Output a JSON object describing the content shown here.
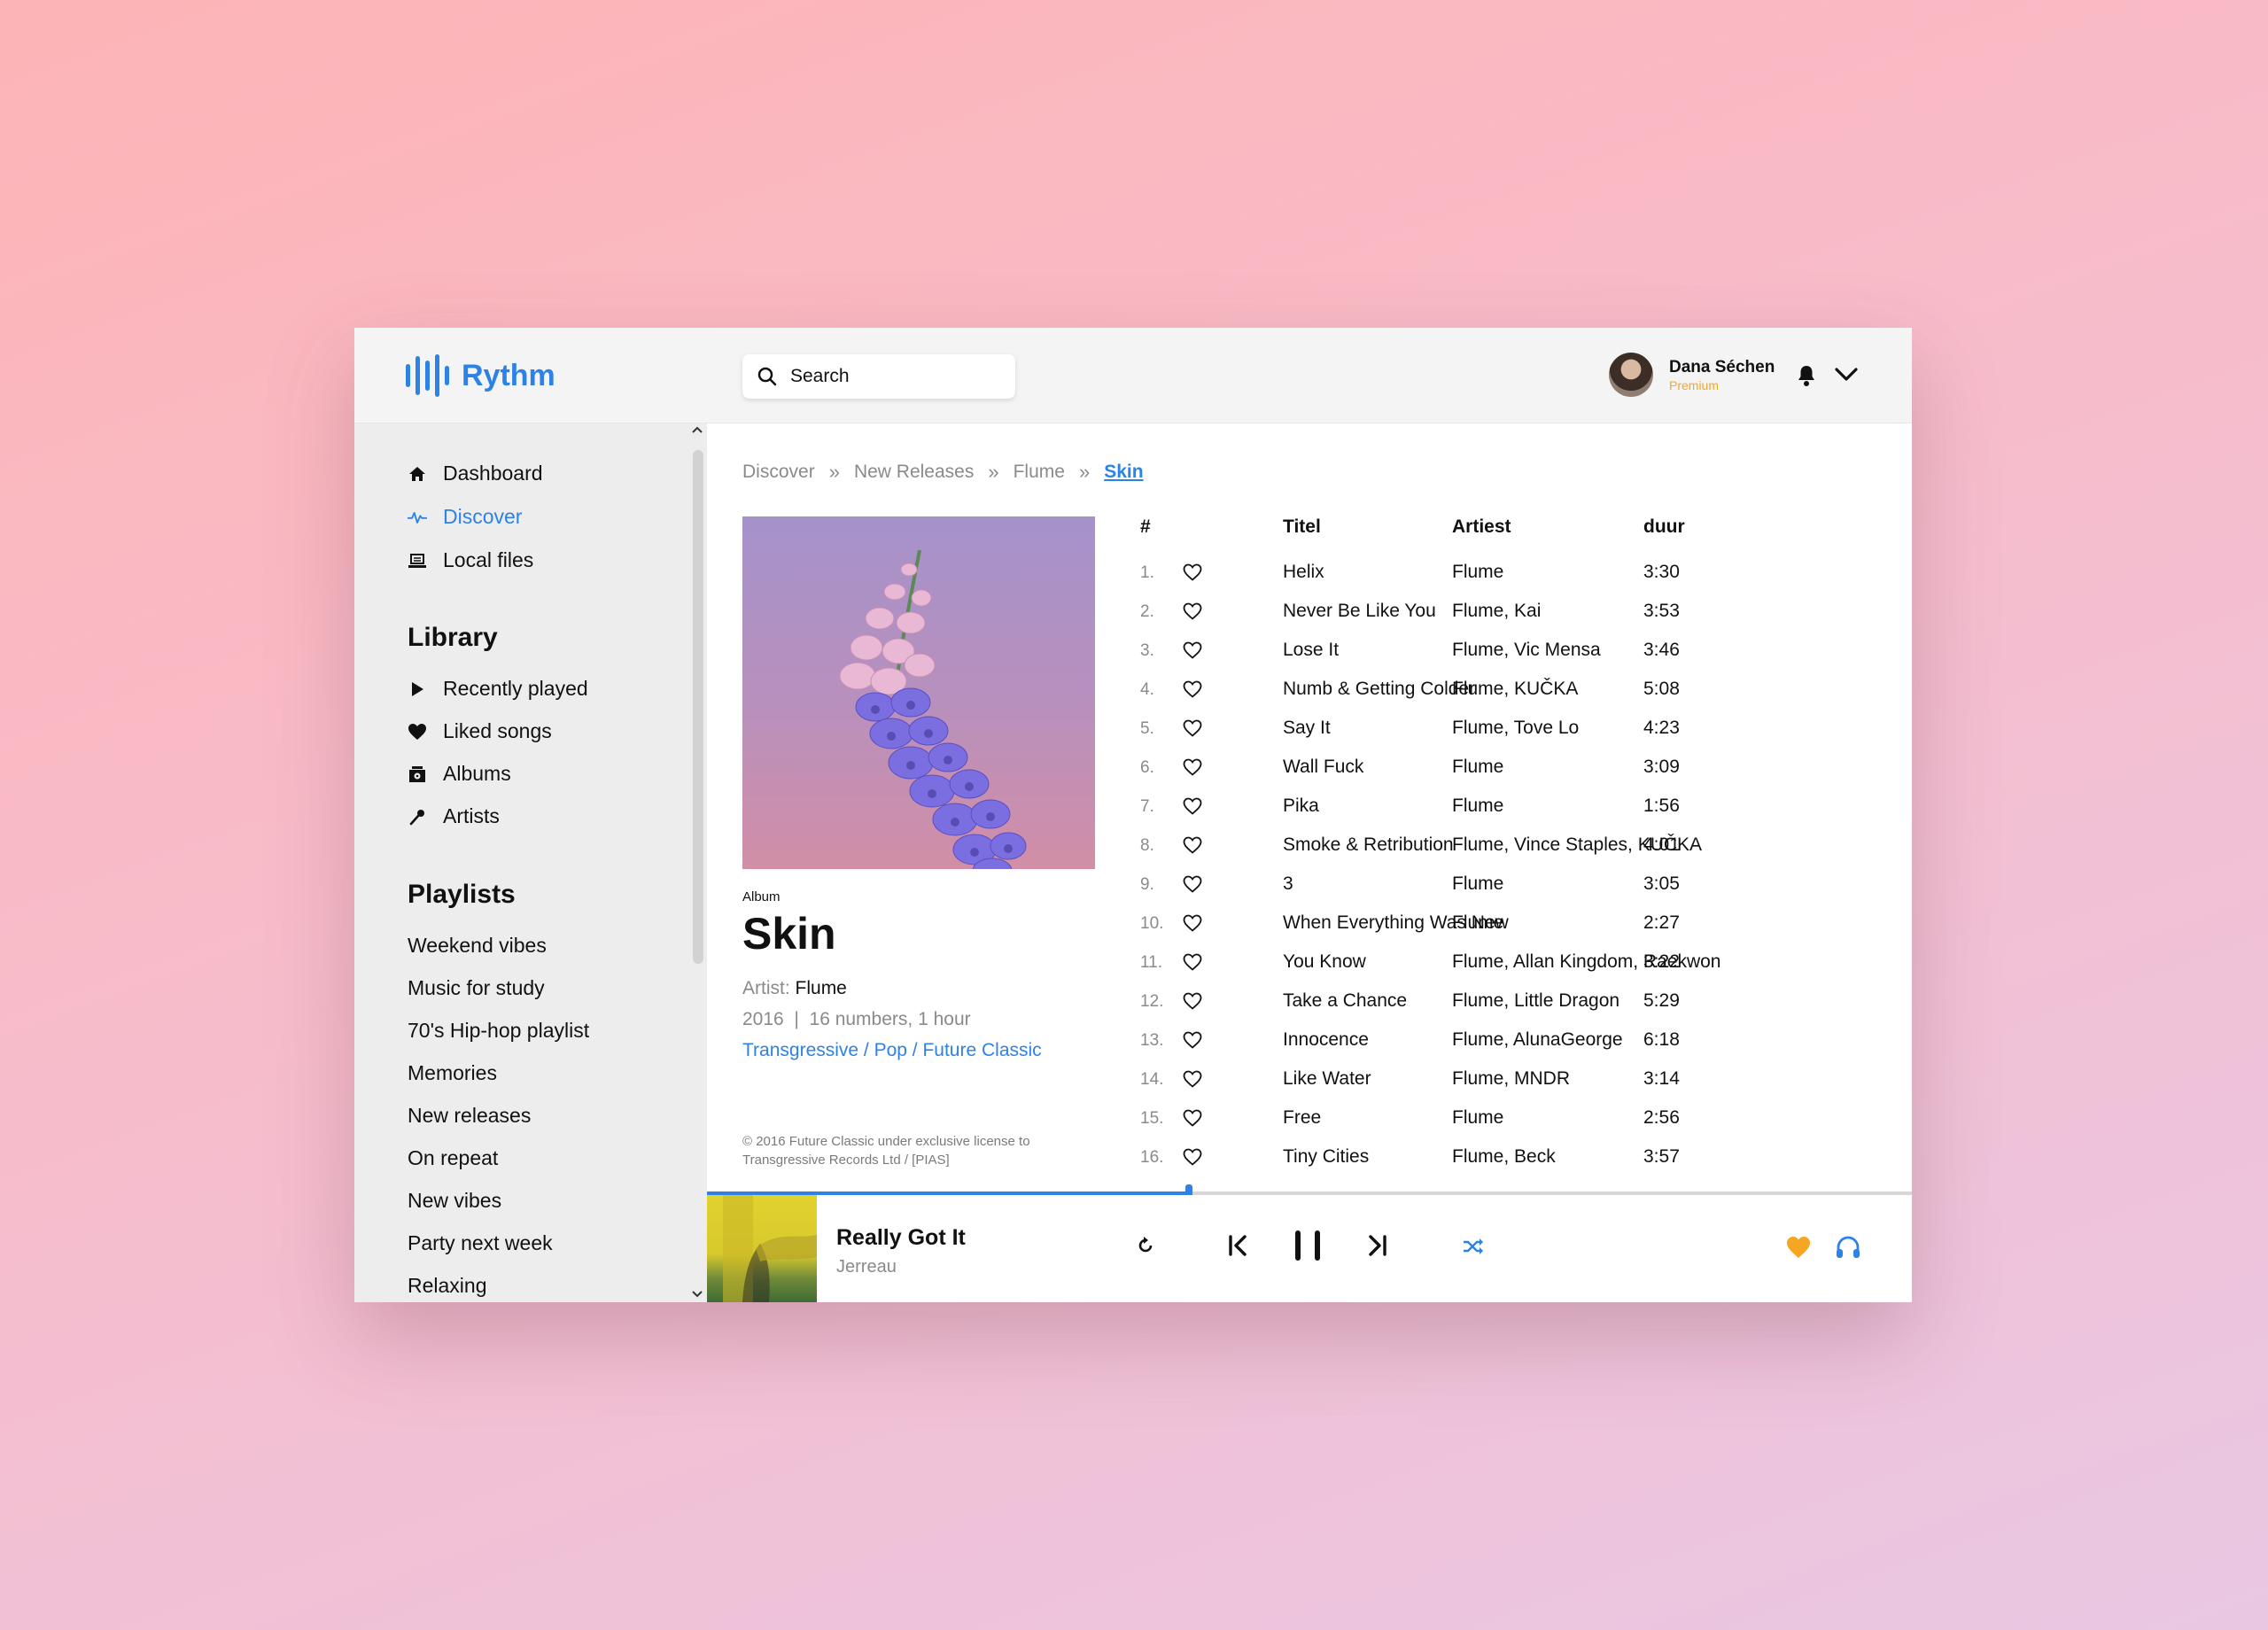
{
  "app": {
    "name": "Rythm"
  },
  "search": {
    "placeholder": "Search"
  },
  "user": {
    "name": "Dana Séchen",
    "tier": "Premium"
  },
  "nav": [
    {
      "label": "Dashboard",
      "icon": "home-icon"
    },
    {
      "label": "Discover",
      "icon": "pulse-icon",
      "active": true
    },
    {
      "label": "Local files",
      "icon": "laptop-icon"
    }
  ],
  "library": {
    "heading": "Library",
    "items": [
      {
        "label": "Recently played",
        "icon": "play-icon"
      },
      {
        "label": "Liked songs",
        "icon": "heart-icon"
      },
      {
        "label": "Albums",
        "icon": "album-icon"
      },
      {
        "label": "Artists",
        "icon": "microphone-icon"
      }
    ]
  },
  "playlists": {
    "heading": "Playlists",
    "items": [
      "Weekend vibes",
      "Music for study",
      "70's Hip-hop playlist",
      "Memories",
      "New releases",
      "On repeat",
      "New vibes",
      "Party next week",
      "Relaxing"
    ]
  },
  "breadcrumb": [
    "Discover",
    "New Releases",
    "Flume",
    "Skin"
  ],
  "album": {
    "kind": "Album",
    "title": "Skin",
    "artist_label": "Artist:",
    "artist": "Flume",
    "meta": "2016  |  16 numbers, 1 hour",
    "genres": "Transgressive / Pop / Future Classic",
    "copyright": "© 2016 Future Classic under exclusive license to Transgressive Records Ltd / [PIAS]"
  },
  "tracklist": {
    "headers": {
      "num": "#",
      "title": "Titel",
      "artist": "Artiest",
      "duration": "duur"
    },
    "rows": [
      {
        "num": "1.",
        "title": "Helix",
        "artist": "Flume",
        "duration": "3:30"
      },
      {
        "num": "2.",
        "title": "Never Be Like You",
        "artist": "Flume, Kai",
        "duration": "3:53"
      },
      {
        "num": "3.",
        "title": "Lose It",
        "artist": "Flume, Vic Mensa",
        "duration": "3:46"
      },
      {
        "num": "4.",
        "title": "Numb & Getting Colder",
        "artist": "Flume, KUČKA",
        "duration": "5:08"
      },
      {
        "num": "5.",
        "title": "Say It",
        "artist": "Flume, Tove Lo",
        "duration": "4:23"
      },
      {
        "num": "6.",
        "title": "Wall Fuck",
        "artist": "Flume",
        "duration": "3:09"
      },
      {
        "num": "7.",
        "title": "Pika",
        "artist": "Flume",
        "duration": "1:56"
      },
      {
        "num": "8.",
        "title": "Smoke & Retribution",
        "artist": "Flume, Vince Staples, KUČKA",
        "duration": "4:01"
      },
      {
        "num": "9.",
        "title": "3",
        "artist": "Flume",
        "duration": "3:05"
      },
      {
        "num": "10.",
        "title": "When Everything Was New",
        "artist": "Flume",
        "duration": "2:27"
      },
      {
        "num": "11.",
        "title": "You Know",
        "artist": "Flume, Allan Kingdom, Raekwon",
        "duration": "3:22"
      },
      {
        "num": "12.",
        "title": "Take a Chance",
        "artist": "Flume, Little Dragon",
        "duration": "5:29"
      },
      {
        "num": "13.",
        "title": "Innocence",
        "artist": "Flume, AlunaGeorge",
        "duration": "6:18"
      },
      {
        "num": "14.",
        "title": "Like Water",
        "artist": "Flume, MNDR",
        "duration": "3:14"
      },
      {
        "num": "15.",
        "title": "Free",
        "artist": "Flume",
        "duration": "2:56"
      },
      {
        "num": "16.",
        "title": "Tiny Cities",
        "artist": "Flume, Beck",
        "duration": "3:57"
      }
    ]
  },
  "player": {
    "title": "Really Got It",
    "artist": "Jerreau",
    "progress": 0.4,
    "controls": [
      "repeat-icon",
      "previous-icon",
      "pause-icon",
      "next-icon",
      "shuffle-icon"
    ],
    "liked": true
  },
  "colors": {
    "accent": "#2d82e6",
    "premium": "#f5a623",
    "like": "#f5a623"
  }
}
